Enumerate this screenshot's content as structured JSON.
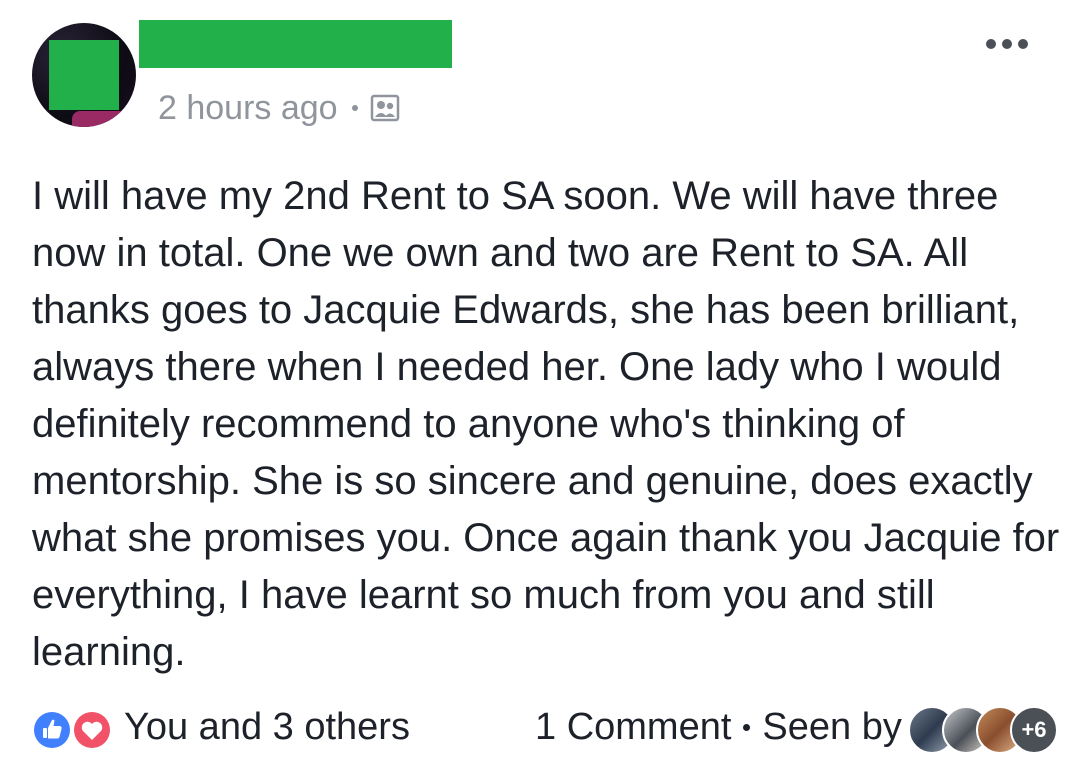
{
  "post": {
    "timestamp": "2 hours ago",
    "privacy_icon": "group-privacy-icon",
    "more_icon": "more-options-icon",
    "body": "I will have my 2nd Rent to SA soon. We will have three now in total. One we own and two are Rent to SA. All thanks goes to Jacquie Edwards, she has been brilliant, always there when I needed her. One lady who I would definitely recommend to anyone who's thinking of mentorship. She is so sincere and genuine, does exactly what she promises you. Once again thank you Jacquie for everything, I have learnt so much from you and still learning."
  },
  "footer": {
    "reaction_icons": [
      "like-icon",
      "love-icon"
    ],
    "reactions_text": "You and 3 others",
    "comments_text": "1 Comment",
    "seen_by_text": "Seen by",
    "seen_more": "+6"
  },
  "colors": {
    "redaction": "#22b04a",
    "like": "#4080ff",
    "love": "#f25268",
    "meta_gray": "#90949c",
    "text": "#1d2129"
  }
}
